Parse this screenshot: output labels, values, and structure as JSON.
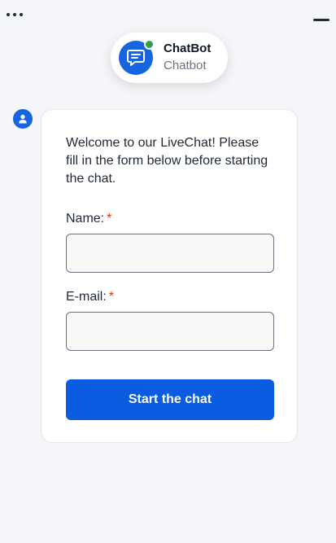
{
  "window_controls": {
    "more_icon": "more-horizontal-icon",
    "minimize_icon": "minimize-icon"
  },
  "header": {
    "bot_name": "ChatBot",
    "bot_subtitle": "Chatbot",
    "avatar_icon": "chat-bubble-icon",
    "status": "online",
    "status_color": "#2f9e5b",
    "accent_color": "#1565e0"
  },
  "message": {
    "sender_icon": "user-icon",
    "welcome_text": "Welcome to our LiveChat! Please fill in the form below before starting the chat."
  },
  "form": {
    "name_label": "Name:",
    "name_required_mark": "*",
    "name_value": "",
    "email_label": "E-mail:",
    "email_required_mark": "*",
    "email_value": "",
    "submit_label": "Start the chat",
    "button_color": "#0a5ce0"
  }
}
